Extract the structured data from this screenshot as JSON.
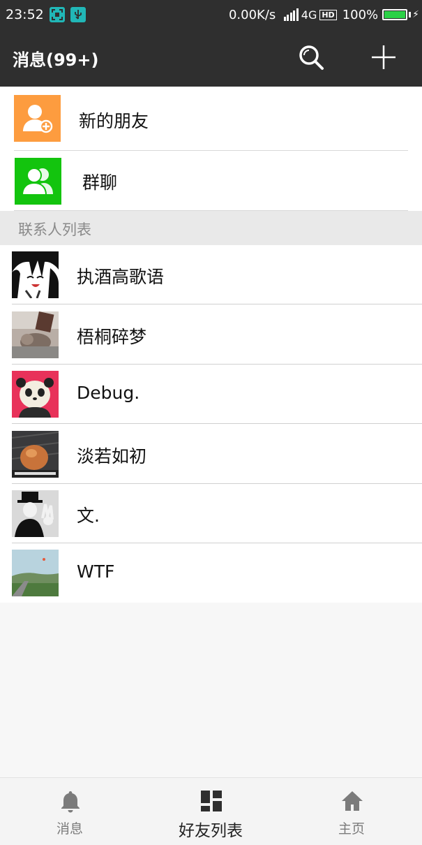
{
  "status_bar": {
    "time": "23:52",
    "speed": "0.00K/s",
    "network": "4G",
    "hd": "HD",
    "battery": "100%",
    "battery_level": 1.0,
    "accent": "#2bd146"
  },
  "header": {
    "title": "消息(99+)"
  },
  "top_entries": [
    {
      "label": "新的朋友",
      "icon": "add-friend-icon",
      "color": "#fd9c3f"
    },
    {
      "label": "群聊",
      "icon": "group-chat-icon",
      "color": "#13c40e"
    }
  ],
  "section": {
    "title": "联系人列表"
  },
  "contacts": [
    {
      "name": "执酒高歌语"
    },
    {
      "name": "梧桐碎梦"
    },
    {
      "name": "Debug."
    },
    {
      "name": "淡若如初"
    },
    {
      "name": "文."
    },
    {
      "name": "WTF"
    }
  ],
  "bottom_nav": {
    "items": [
      {
        "label": "消息",
        "icon": "bell-icon",
        "active": false
      },
      {
        "label": "好友列表",
        "icon": "dashboard-icon",
        "active": true
      },
      {
        "label": "主页",
        "icon": "home-icon",
        "active": false
      }
    ]
  }
}
